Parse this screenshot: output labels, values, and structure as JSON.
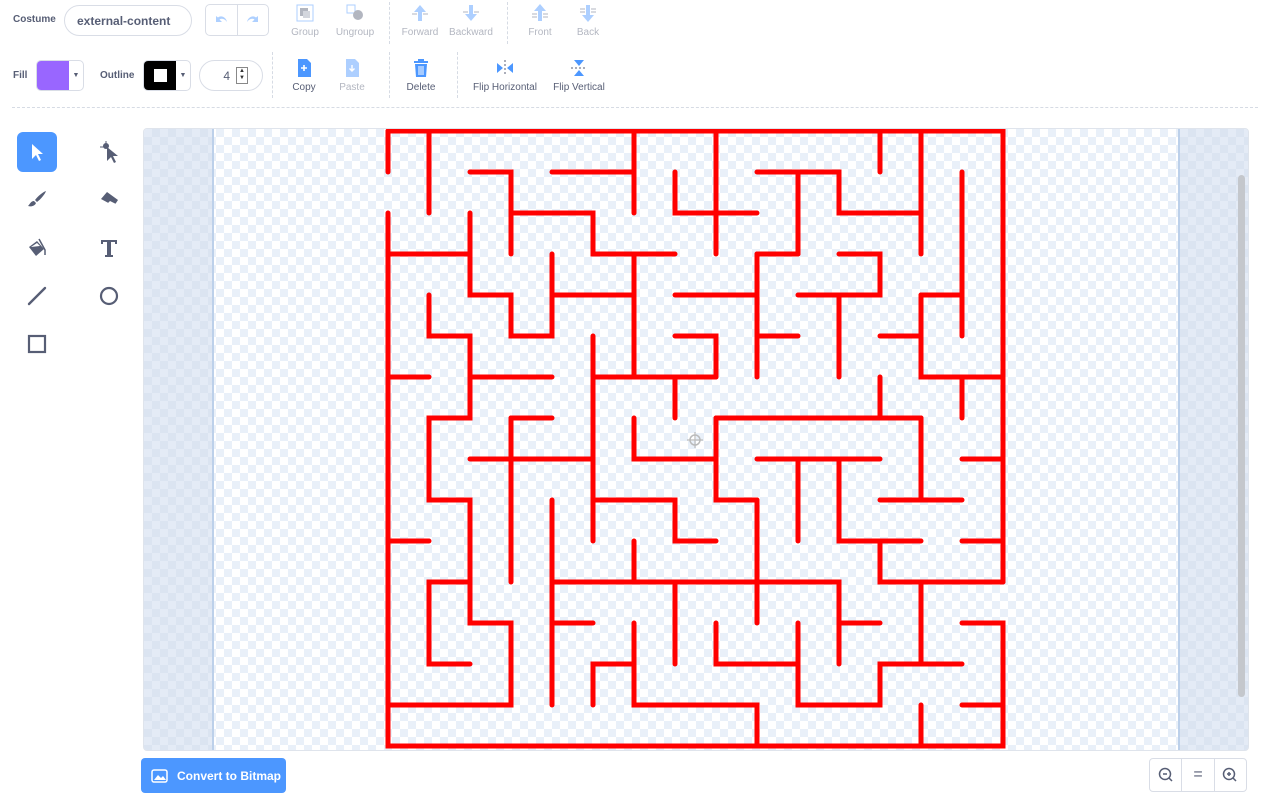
{
  "toolbar": {
    "costume_label": "Costume",
    "costume_name": "external-content",
    "undo": "undo-icon",
    "redo": "redo-icon",
    "group": "Group",
    "ungroup": "Ungroup",
    "forward": "Forward",
    "backward": "Backward",
    "front": "Front",
    "back": "Back",
    "fill_label": "Fill",
    "fill_color": "#9966ff",
    "outline_label": "Outline",
    "outline_color": "#000000",
    "outline_width": "4",
    "copy": "Copy",
    "paste": "Paste",
    "delete": "Delete",
    "flip_horizontal": "Flip Horizontal",
    "flip_vertical": "Flip Vertical"
  },
  "tools": [
    "select",
    "reshape",
    "brush",
    "eraser",
    "fill",
    "text",
    "line",
    "circle",
    "rectangle"
  ],
  "active_tool": "select",
  "canvas": {
    "stroke_color": "#ff0000"
  },
  "bottom": {
    "convert_button": "Convert to Bitmap",
    "zoom_out": "zoom-out-icon",
    "zoom_reset": "=",
    "zoom_in": "zoom-in-icon"
  },
  "accent_color": "#4c97ff"
}
